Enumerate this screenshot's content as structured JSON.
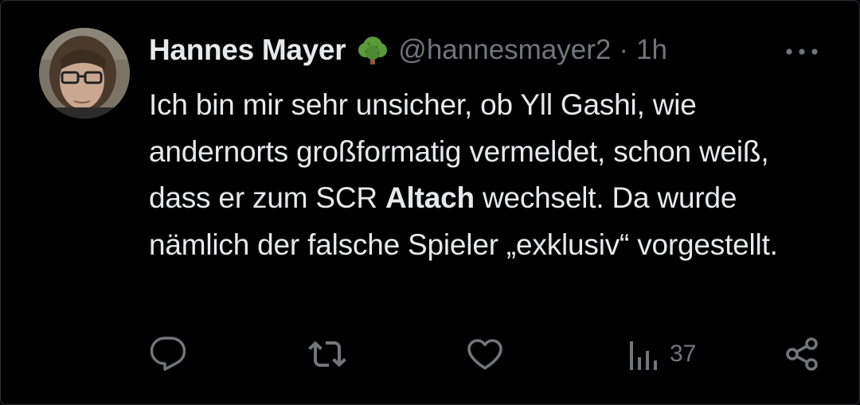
{
  "tweet": {
    "author_name": "Hannes Mayer",
    "author_badge": "tree-emoji-icon",
    "handle": "@hannesmayer2",
    "separator": "·",
    "time": "1h",
    "text_part1": "Ich bin mir sehr unsicher, ob Yll Gashi, wie andernorts großformatig vermeldet, schon weiß, dass er zum SCR ",
    "text_bold": "Altach",
    "text_part2": " wechselt. Da wurde nämlich der falsche Spieler „exklusiv“ vorgestellt."
  },
  "actions": {
    "views": "37"
  },
  "icons": [
    "reply-icon",
    "retweet-icon",
    "like-icon",
    "views-icon",
    "share-icon",
    "more-icon"
  ],
  "colors": {
    "background": "#000000",
    "text": "#e7e9ea",
    "secondary": "#71767b"
  }
}
